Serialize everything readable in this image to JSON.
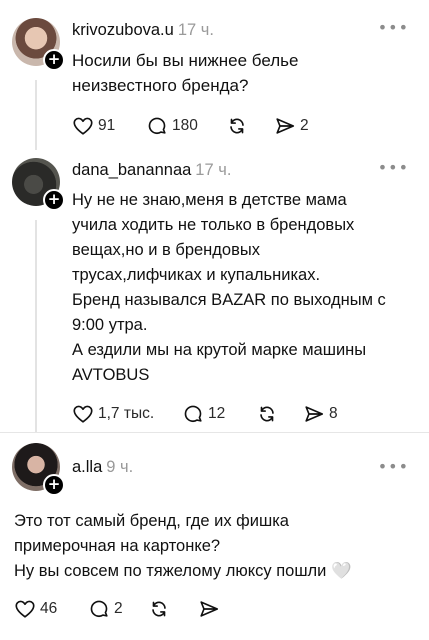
{
  "posts": [
    {
      "username": "krivozubova.u",
      "time": "17 ч.",
      "text_lines": [
        "Носили бы вы нижнее белье",
        "неизвестного бренда?"
      ],
      "likes": "91",
      "comments": "180",
      "shares": "2"
    },
    {
      "username": "dana_banannaa",
      "time": "17 ч.",
      "text_lines": [
        "Ну не не знаю,меня в детстве мама",
        "учила ходить не только в брендовых",
        "вещах,но и в брендовых",
        "трусах,лифчиках и купальниках.",
        "Бренд назывался BAZAR по выходным с",
        "9:00 утра.",
        "А ездили мы на крутой марке машины",
        "AVTOBUS"
      ],
      "likes": "1,7 тыс.",
      "comments": "12",
      "shares": "8"
    },
    {
      "username": "a.lla",
      "time": "9 ч.",
      "text_lines": [
        "Это тот самый бренд, где их фишка",
        "примерочная  на картонке?",
        "Ну вы совсем по тяжелому люксу пошли 🤍"
      ],
      "likes": "46",
      "comments": "2",
      "shares": ""
    }
  ],
  "icons": {
    "more": "more-dots-icon",
    "like": "heart-icon",
    "comment": "comment-bubble-icon",
    "repost": "repost-icon",
    "share": "send-icon",
    "follow": "plus-icon"
  },
  "colors": {
    "time": "#9a9a9a",
    "thread_line": "#e3e3e3"
  }
}
